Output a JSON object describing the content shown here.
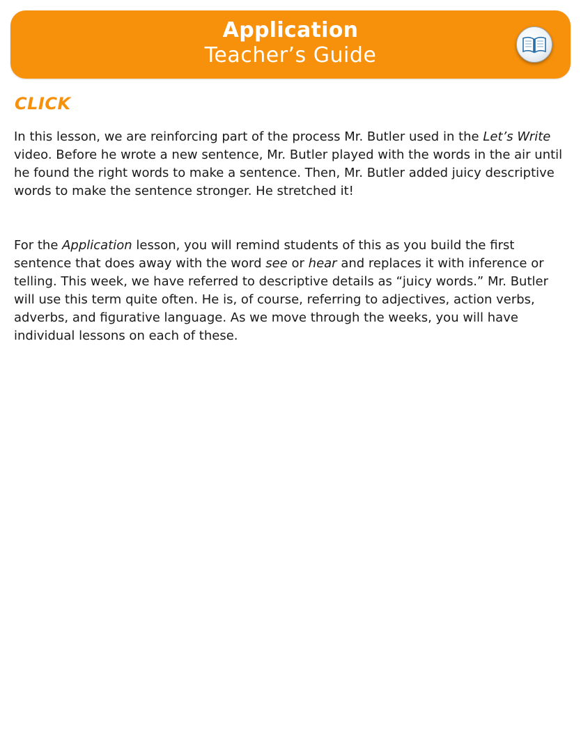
{
  "header": {
    "title": "Application",
    "subtitle": "Teacher’s Guide",
    "icon": "open-book-icon",
    "bg_color": "#f7900a"
  },
  "section_label": "CLICK",
  "paragraph1": {
    "part1": "In this lesson, we are reinforcing part of the process Mr. Butler used in the ",
    "italic1": "Let’s Write",
    "part2": " video. Before he wrote a new sentence, Mr. Butler played with the words in the air until he found the right words to make a sentence. Then, Mr. Butler added juicy descriptive words to make the sentence stronger. He stretched it!"
  },
  "paragraph2": {
    "part1": "For the ",
    "italic1": "Application",
    "part2": " lesson, you will remind students of this as you build the first sentence that does away with the word ",
    "italic2": "see",
    "part3": " or ",
    "italic3": "hear",
    "part4": " and replaces it with inference or telling. This week, we have referred to descriptive details as “juicy words.” Mr. Butler will use this term quite often. He is, of course, referring to adjectives, action verbs, adverbs, and figurative language. As we move through the weeks, you will have individual lessons on each of these."
  }
}
